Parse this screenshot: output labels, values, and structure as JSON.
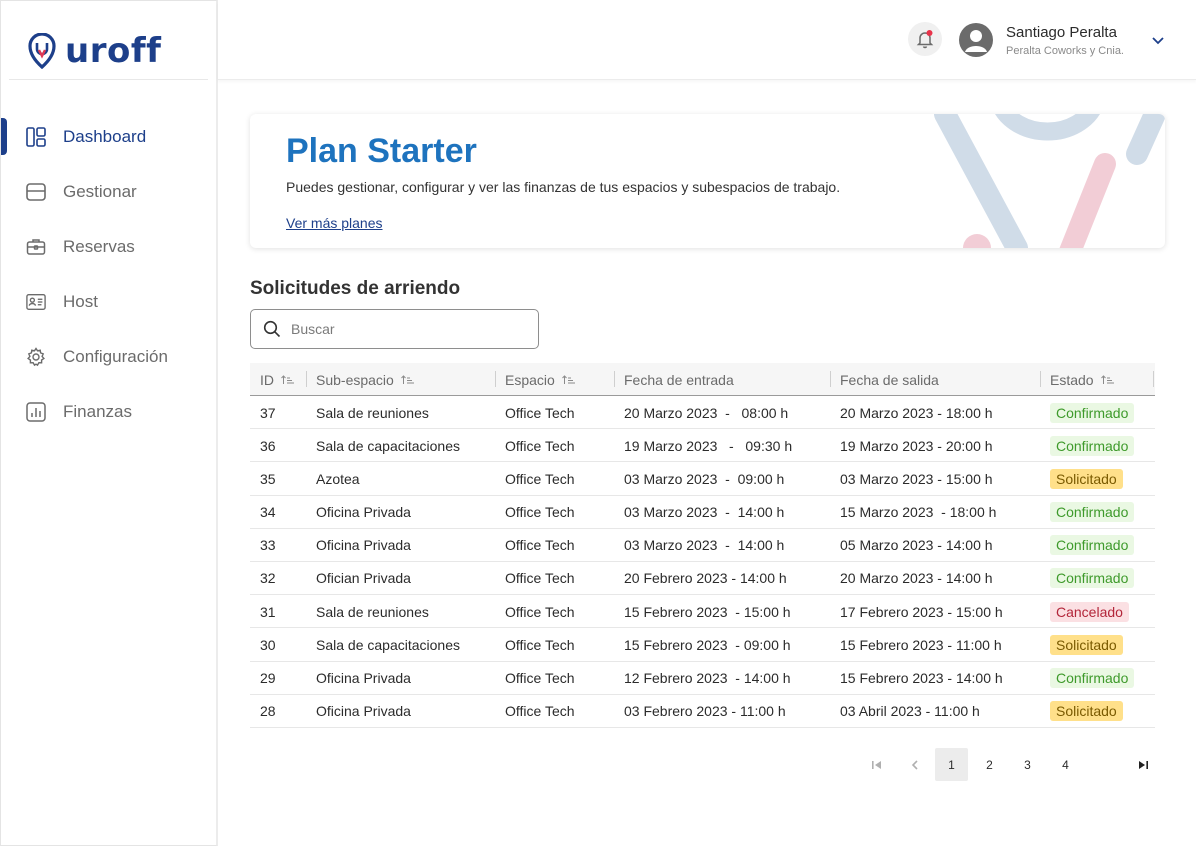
{
  "brand": {
    "name": "uroff"
  },
  "sidebar": {
    "items": [
      {
        "label": "Dashboard",
        "icon": "dashboard-icon",
        "active": true
      },
      {
        "label": "Gestionar",
        "icon": "manage-icon",
        "active": false
      },
      {
        "label": "Reservas",
        "icon": "briefcase-icon",
        "active": false
      },
      {
        "label": "Host",
        "icon": "id-card-icon",
        "active": false
      },
      {
        "label": "Configuración",
        "icon": "gear-icon",
        "active": false
      },
      {
        "label": "Finanzas",
        "icon": "chart-icon",
        "active": false
      }
    ]
  },
  "header": {
    "user_name": "Santiago Peralta",
    "user_company": "Peralta Coworks y Cnia.",
    "notification_color": "#e8334a"
  },
  "plan": {
    "title": "Plan Starter",
    "description": "Puedes gestionar, configurar y ver las finanzas de tus espacios y subespacios de trabajo.",
    "link": "Ver más planes"
  },
  "requests": {
    "title": "Solicitudes de arriendo",
    "search_placeholder": "Buscar",
    "columns": [
      "ID",
      "Sub-espacio",
      "Espacio",
      "Fecha de entrada",
      "Fecha de salida",
      "Estado"
    ],
    "rows": [
      {
        "id": "37",
        "subspace": "Sala de reuniones",
        "space": "Office Tech",
        "entry": "20 Marzo 2023  -   08:00 h",
        "exit": "20 Marzo 2023 - 18:00 h",
        "status": "Confirmado"
      },
      {
        "id": "36",
        "subspace": "Sala de capacitaciones",
        "space": "Office Tech",
        "entry": "19 Marzo 2023   -   09:30 h",
        "exit": "19 Marzo 2023 - 20:00 h",
        "status": "Confirmado"
      },
      {
        "id": "35",
        "subspace": "Azotea",
        "space": "Office Tech",
        "entry": "03 Marzo 2023  -  09:00 h",
        "exit": "03 Marzo 2023 - 15:00 h",
        "status": "Solicitado"
      },
      {
        "id": "34",
        "subspace": "Oficina Privada",
        "space": "Office Tech",
        "entry": "03 Marzo 2023  -  14:00 h",
        "exit": "15 Marzo 2023  - 18:00 h",
        "status": "Confirmado"
      },
      {
        "id": "33",
        "subspace": "Oficina Privada",
        "space": "Office Tech",
        "entry": "03 Marzo 2023  -  14:00 h",
        "exit": "05 Marzo 2023 - 14:00 h",
        "status": "Confirmado"
      },
      {
        "id": "32",
        "subspace": "Ofician Privada",
        "space": "Office Tech",
        "entry": "20 Febrero 2023 - 14:00 h",
        "exit": "20 Marzo 2023 - 14:00 h",
        "status": "Confirmado"
      },
      {
        "id": "31",
        "subspace": "Sala de reuniones",
        "space": "Office Tech",
        "entry": "15 Febrero 2023  - 15:00 h",
        "exit": "17 Febrero 2023 - 15:00 h",
        "status": "Cancelado"
      },
      {
        "id": "30",
        "subspace": "Sala de capacitaciones",
        "space": "Office Tech",
        "entry": "15 Febrero 2023  - 09:00 h",
        "exit": "15 Febrero 2023 - 11:00 h",
        "status": "Solicitado"
      },
      {
        "id": "29",
        "subspace": "Oficina Privada",
        "space": "Office Tech",
        "entry": "12 Febrero 2023  - 14:00 h",
        "exit": "15 Febrero 2023 - 14:00 h",
        "status": "Confirmado"
      },
      {
        "id": "28",
        "subspace": "Oficina Privada",
        "space": "Office Tech",
        "entry": "03 Febrero 2023 - 11:00 h",
        "exit": "03 Abril 2023 - 11:00 h",
        "status": "Solicitado"
      }
    ]
  },
  "pagination": {
    "pages": [
      "1",
      "2",
      "3",
      "4"
    ],
    "current": "1"
  }
}
